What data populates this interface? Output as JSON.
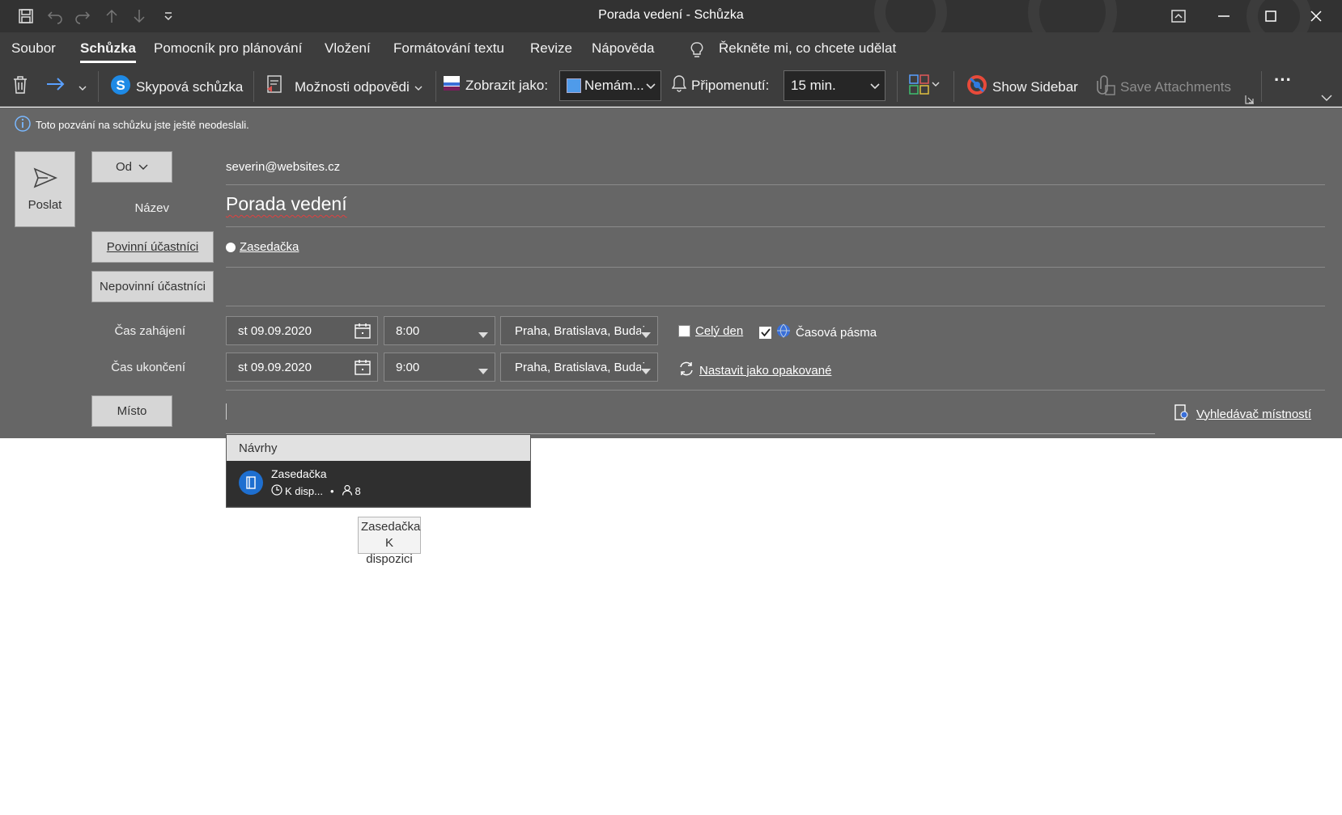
{
  "window": {
    "title": "Porada vedení  -  Schůzka"
  },
  "menu": {
    "items": [
      "Soubor",
      "Schůzka",
      "Pomocník pro plánování",
      "Vložení",
      "Formátování textu",
      "Revize",
      "Nápověda"
    ],
    "tell_me": "Řekněte mi, co chcete udělat"
  },
  "ribbon": {
    "skype": "Skypová schůzka",
    "response_options": "Možnosti odpovědi",
    "show_as_label": "Zobrazit jako:",
    "show_as_value": "Nemám...",
    "reminder_label": "Připomenutí:",
    "reminder_value": "15 min.",
    "show_sidebar": "Show Sidebar",
    "save_attachments": "Save Attachments",
    "more": "···"
  },
  "form": {
    "info_bar": "Toto pozvání na schůzku jste ještě neodeslali.",
    "send": "Poslat",
    "from_button": "Od",
    "from_value": "severin@websites.cz",
    "title_label": "Název",
    "title_value": "Porada vedení",
    "required_button": "Povinní účastníci",
    "required_value": "Zasedačka",
    "optional_button": "Nepovinní účastníci",
    "start_label": "Čas zahájení",
    "start_date": "st 09.09.2020",
    "start_time": "8:00",
    "start_tz": "Praha, Bratislava, Budaj",
    "end_label": "Čas ukončení",
    "end_date": "st 09.09.2020",
    "end_time": "9:00",
    "end_tz": "Praha, Bratislava, Budaj",
    "all_day": "Celý den",
    "time_zones": "Časová pásma",
    "recurrence": "Nastavit jako opakované",
    "location_button": "Místo",
    "room_finder": "Vyhledávač místností"
  },
  "suggestions": {
    "header": "Návrhy",
    "room_name": "Zasedačka",
    "availability": "K disp...",
    "capacity": "8"
  },
  "tooltip": {
    "line1": "Zasedačka",
    "line2": "K dispozici"
  }
}
